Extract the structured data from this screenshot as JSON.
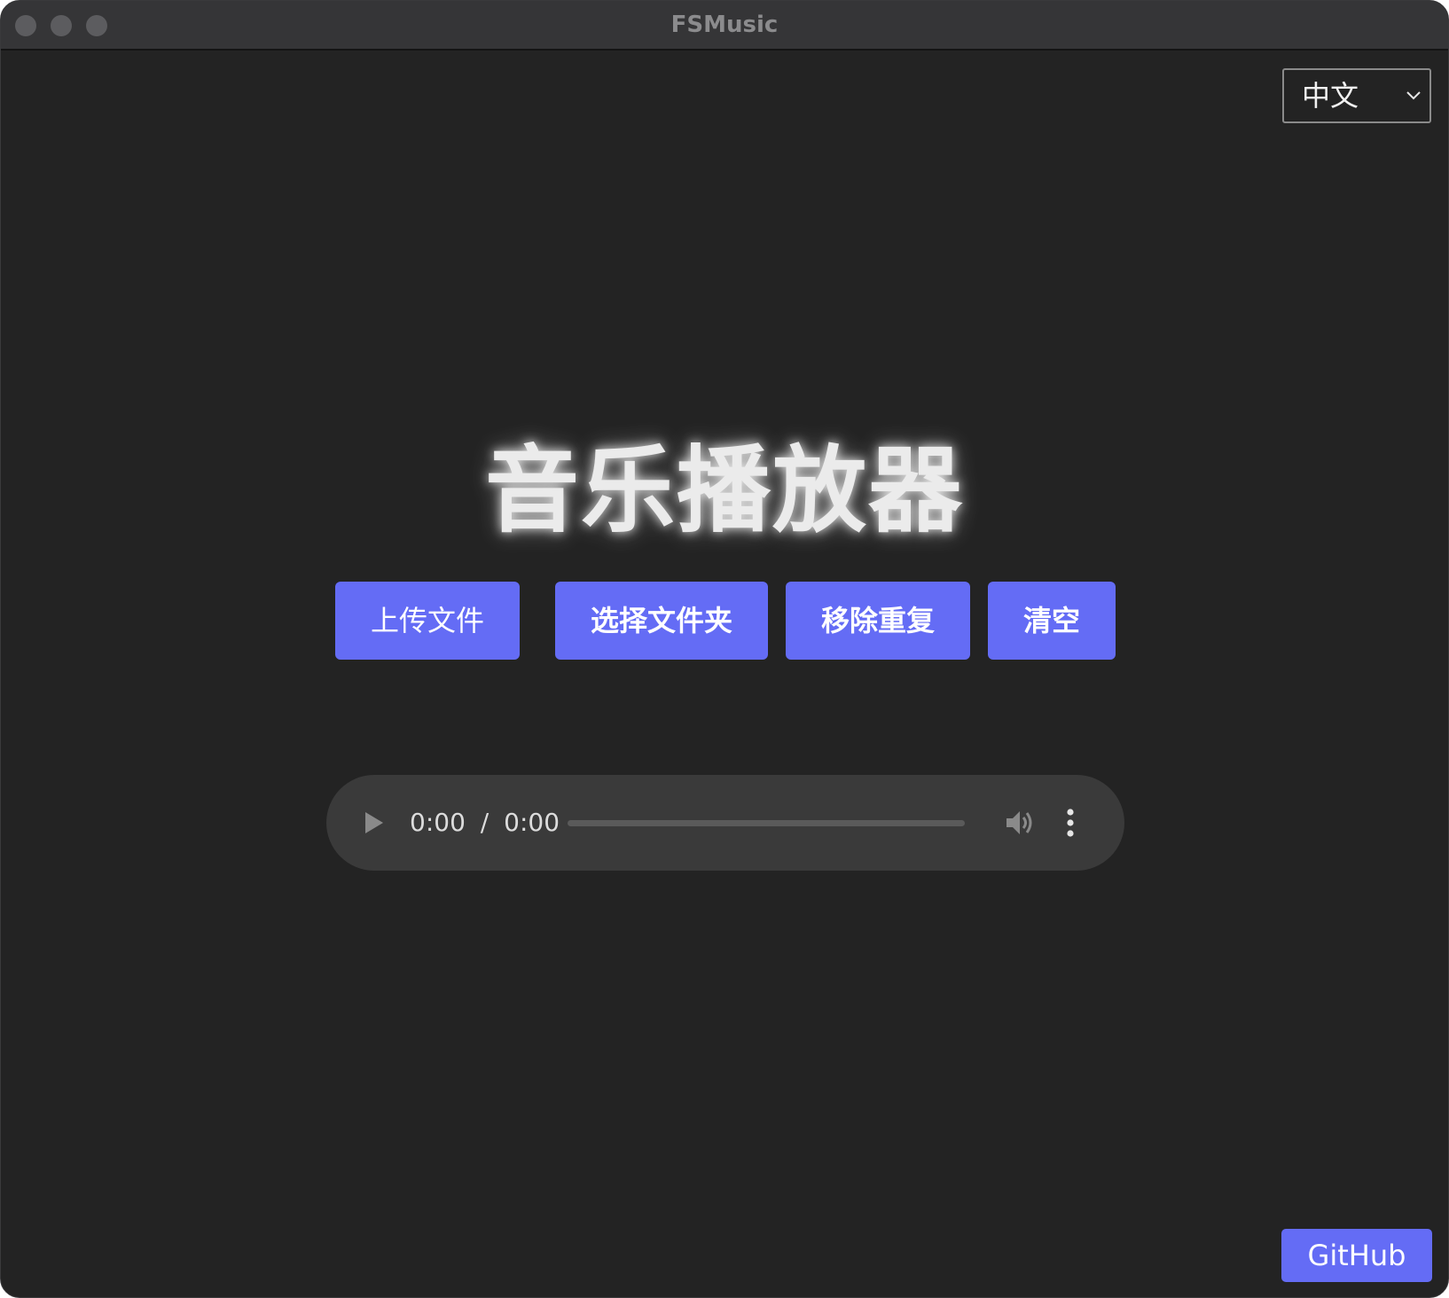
{
  "window": {
    "title": "FSMusic"
  },
  "language": {
    "selected": "中文"
  },
  "main": {
    "heading": "音乐播放器",
    "buttons": {
      "upload": "上传文件",
      "select_folder": "选择文件夹",
      "remove_duplicates": "移除重复",
      "clear": "清空"
    }
  },
  "player": {
    "current_time": "0:00",
    "separator": "/",
    "duration": "0:00",
    "progress": 0
  },
  "footer": {
    "github_label": "GitHub"
  },
  "colors": {
    "accent": "#646cf5",
    "background": "#232323",
    "titlebar": "#353537"
  },
  "icons": [
    "play-icon",
    "volume-icon",
    "more-vertical-icon",
    "chevron-down-icon"
  ]
}
